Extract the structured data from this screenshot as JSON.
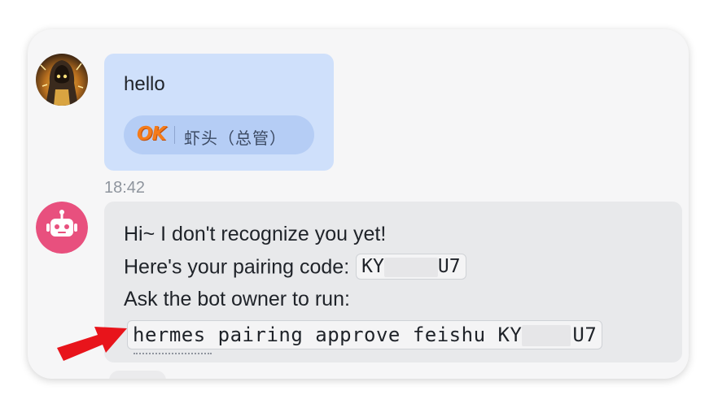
{
  "chat": {
    "user_message": {
      "avatar_icon": "hooded-figure-avatar",
      "text": "hello",
      "reaction": {
        "emoji_text": "OK",
        "emoji_color": "#f47b1a",
        "reactor_name": "虾头（总管）"
      },
      "timestamp": "18:42",
      "bubble_color": "#cfe0fb"
    },
    "bot_message": {
      "avatar_icon": "robot-icon",
      "avatar_color": "#e8507e",
      "line1": "Hi~ I don't recognize you yet!",
      "line2_label": "Here's your pairing code:",
      "pairing_code_prefix": "KY",
      "pairing_code_suffix": "U7",
      "line3": "Ask the bot owner to run:",
      "command_text": "hermes pairing approve feishu KY",
      "command_suffix": "U7",
      "bubble_color": "#e8e9eb"
    }
  },
  "annotation": {
    "arrow_icon": "red-arrow-icon",
    "arrow_color": "#e8141b"
  }
}
